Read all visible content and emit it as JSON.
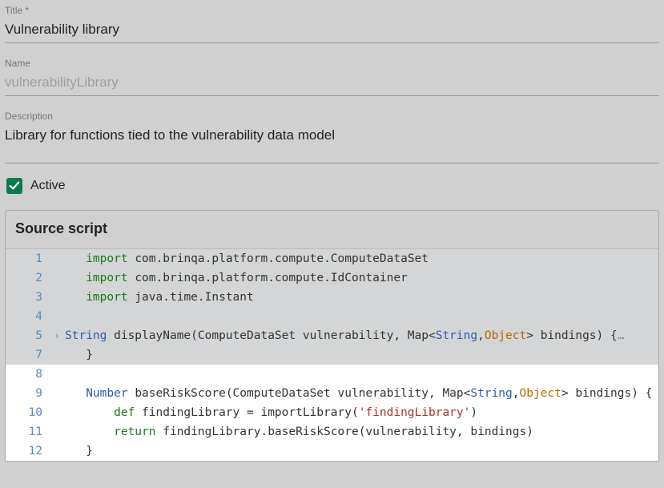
{
  "fields": {
    "title_label": "Title *",
    "title_value": "Vulnerability library",
    "name_label": "Name",
    "name_value": "vulnerabilityLibrary",
    "description_label": "Description",
    "description_value": "Library for functions tied to the vulnerability data model"
  },
  "active": {
    "label": "Active",
    "checked": true
  },
  "script": {
    "header": "Source script",
    "lines": [
      {
        "n": "1",
        "dim": true,
        "fold": "",
        "tokens": [
          [
            "pln",
            "   "
          ],
          [
            "kw",
            "import"
          ],
          [
            "pln",
            " com"
          ],
          [
            "pun",
            "."
          ],
          [
            "pln",
            "brinqa"
          ],
          [
            "pun",
            "."
          ],
          [
            "pln",
            "platform"
          ],
          [
            "pun",
            "."
          ],
          [
            "pln",
            "compute"
          ],
          [
            "pun",
            "."
          ],
          [
            "pln",
            "ComputeDataSet"
          ]
        ]
      },
      {
        "n": "2",
        "dim": true,
        "fold": "",
        "tokens": [
          [
            "pln",
            "   "
          ],
          [
            "kw",
            "import"
          ],
          [
            "pln",
            " com"
          ],
          [
            "pun",
            "."
          ],
          [
            "pln",
            "brinqa"
          ],
          [
            "pun",
            "."
          ],
          [
            "pln",
            "platform"
          ],
          [
            "pun",
            "."
          ],
          [
            "pln",
            "compute"
          ],
          [
            "pun",
            "."
          ],
          [
            "pln",
            "IdContainer"
          ]
        ]
      },
      {
        "n": "3",
        "dim": true,
        "fold": "",
        "tokens": [
          [
            "pln",
            "   "
          ],
          [
            "kw",
            "import"
          ],
          [
            "pln",
            " java"
          ],
          [
            "pun",
            "."
          ],
          [
            "pln",
            "time"
          ],
          [
            "pun",
            "."
          ],
          [
            "pln",
            "Instant"
          ]
        ]
      },
      {
        "n": "4",
        "dim": true,
        "fold": "",
        "tokens": []
      },
      {
        "n": "5",
        "dim": true,
        "fold": "›",
        "tokens": [
          [
            "typ",
            "String"
          ],
          [
            "pln",
            " displayName"
          ],
          [
            "pun",
            "("
          ],
          [
            "pln",
            "ComputeDataSet vulnerability"
          ],
          [
            "pun",
            ","
          ],
          [
            "pln",
            " Map"
          ],
          [
            "pun",
            "<"
          ],
          [
            "typ",
            "String"
          ],
          [
            "pun",
            ","
          ],
          [
            "typ2",
            "Object"
          ],
          [
            "pun",
            ">"
          ],
          [
            "pln",
            " bindings"
          ],
          [
            "pun",
            ")"
          ],
          [
            "pln",
            " "
          ],
          [
            "pun",
            "{"
          ],
          [
            "ellip",
            "…"
          ]
        ]
      },
      {
        "n": "7",
        "dim": true,
        "fold": "",
        "tokens": [
          [
            "pln",
            "   "
          ],
          [
            "pun",
            "}"
          ]
        ]
      },
      {
        "n": "8",
        "dim": false,
        "fold": "",
        "tokens": []
      },
      {
        "n": "9",
        "dim": false,
        "fold": "",
        "tokens": [
          [
            "pln",
            "   "
          ],
          [
            "typ",
            "Number"
          ],
          [
            "pln",
            " baseRiskScore"
          ],
          [
            "pun",
            "("
          ],
          [
            "pln",
            "ComputeDataSet vulnerability"
          ],
          [
            "pun",
            ","
          ],
          [
            "pln",
            " Map"
          ],
          [
            "pun",
            "<"
          ],
          [
            "typ",
            "String"
          ],
          [
            "pun",
            ","
          ],
          [
            "typ2",
            "Object"
          ],
          [
            "pun",
            ">"
          ],
          [
            "pln",
            " bindings"
          ],
          [
            "pun",
            ")"
          ],
          [
            "pln",
            " "
          ],
          [
            "pun",
            "{"
          ]
        ]
      },
      {
        "n": "10",
        "dim": false,
        "fold": "",
        "tokens": [
          [
            "pln",
            "       "
          ],
          [
            "kw",
            "def"
          ],
          [
            "pln",
            " findingLibrary "
          ],
          [
            "pun",
            "="
          ],
          [
            "pln",
            " importLibrary"
          ],
          [
            "pun",
            "("
          ],
          [
            "str",
            "'findingLibrary'"
          ],
          [
            "pun",
            ")"
          ]
        ]
      },
      {
        "n": "11",
        "dim": false,
        "fold": "",
        "tokens": [
          [
            "pln",
            "       "
          ],
          [
            "kw",
            "return"
          ],
          [
            "pln",
            " findingLibrary"
          ],
          [
            "pun",
            "."
          ],
          [
            "pln",
            "baseRiskScore"
          ],
          [
            "pun",
            "("
          ],
          [
            "pln",
            "vulnerability"
          ],
          [
            "pun",
            ","
          ],
          [
            "pln",
            " bindings"
          ],
          [
            "pun",
            ")"
          ]
        ]
      },
      {
        "n": "12",
        "dim": false,
        "fold": "",
        "tokens": [
          [
            "pln",
            "   "
          ],
          [
            "pun",
            "}"
          ]
        ]
      }
    ]
  }
}
